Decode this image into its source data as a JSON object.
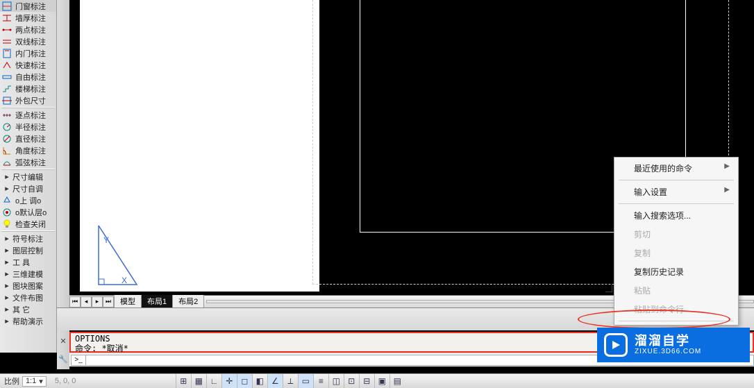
{
  "toolbar": {
    "items": [
      {
        "id": "door-dim",
        "label": "门窗标注",
        "iconColor": "#06c"
      },
      {
        "id": "wall-thick",
        "label": "墙厚标注",
        "iconColor": "#b00"
      },
      {
        "id": "two-point",
        "label": "两点标注",
        "iconColor": "#b00"
      },
      {
        "id": "double-line",
        "label": "双线标注",
        "iconColor": "#b00"
      },
      {
        "id": "inner-door",
        "label": "内门标注",
        "iconColor": "#06c"
      },
      {
        "id": "fast-dim",
        "label": "快速标注",
        "iconColor": "#b00"
      },
      {
        "id": "free-dim",
        "label": "自由标注",
        "iconColor": "#06c"
      },
      {
        "id": "stair-dim",
        "label": "楼梯标注",
        "iconColor": "#088"
      },
      {
        "id": "outer-size",
        "label": "外包尺寸",
        "iconColor": "#06c"
      },
      {
        "id": "sep1",
        "sep": true
      },
      {
        "id": "point-by-point",
        "label": "逐点标注",
        "iconColor": "#06c"
      },
      {
        "id": "radius",
        "label": "半径标注",
        "iconColor": "#088"
      },
      {
        "id": "diameter",
        "label": "直径标注",
        "iconColor": "#088"
      },
      {
        "id": "angle",
        "label": "角度标注",
        "iconColor": "#b80"
      },
      {
        "id": "arc-chord",
        "label": "弧弦标注",
        "iconColor": "#088"
      },
      {
        "id": "sep2",
        "sep": true
      },
      {
        "id": "size-edit",
        "label": "尺寸编辑",
        "arrow": true
      },
      {
        "id": "size-auto",
        "label": "尺寸自调",
        "arrow": true
      },
      {
        "id": "upper-floor",
        "label": "o上 调o",
        "noarrow": true
      },
      {
        "id": "default-layer",
        "label": "o默认层o",
        "noarrow": true
      },
      {
        "id": "check-close",
        "label": "检查关闭",
        "iconColor": "#cc0"
      },
      {
        "id": "sep3",
        "sep": true
      },
      {
        "id": "symbol-dim",
        "label": "符号标注",
        "arrow": true
      },
      {
        "id": "layer-ctrl",
        "label": "图层控制",
        "arrow": true
      },
      {
        "id": "tools",
        "label": "工    具",
        "arrow": true
      },
      {
        "id": "3d-model",
        "label": "三维建模",
        "arrow": true
      },
      {
        "id": "block-pattern",
        "label": "图块图案",
        "arrow": true
      },
      {
        "id": "file-layout",
        "label": "文件布图",
        "arrow": true
      },
      {
        "id": "other",
        "label": "其    它",
        "arrow": true
      },
      {
        "id": "help-demo",
        "label": "帮助演示",
        "arrow": true
      }
    ]
  },
  "canvas": {
    "triangle": {
      "x": "X",
      "y": "Y"
    }
  },
  "tabs": {
    "items": [
      "模型",
      "布局1",
      "布局2"
    ],
    "active_index": 1
  },
  "command": {
    "history_line1": "OPTIONS",
    "history_line2": "命令: *取消*",
    "prompt_symbol": ">_"
  },
  "status": {
    "scale_label": "比例",
    "scale_value": "1:1",
    "coord": "5, 0, 0"
  },
  "context_menu": {
    "items": [
      {
        "id": "recent-cmd",
        "label": "最近使用的命令",
        "submenu": true
      },
      {
        "id": "sep"
      },
      {
        "id": "input-settings",
        "label": "输入设置",
        "submenu": true
      },
      {
        "id": "sep"
      },
      {
        "id": "input-search",
        "label": "输入搜索选项..."
      },
      {
        "id": "cut",
        "label": "剪切",
        "disabled": true
      },
      {
        "id": "copy",
        "label": "复制",
        "disabled": true
      },
      {
        "id": "copy-history",
        "label": "复制历史记录"
      },
      {
        "id": "paste",
        "label": "粘贴",
        "disabled": true
      },
      {
        "id": "paste-cmd",
        "label": "粘贴到命令行",
        "disabled": true
      },
      {
        "id": "sep"
      }
    ]
  },
  "watermark": {
    "main": "溜溜自学",
    "sub": "ZIXUE.3D66.COM"
  }
}
